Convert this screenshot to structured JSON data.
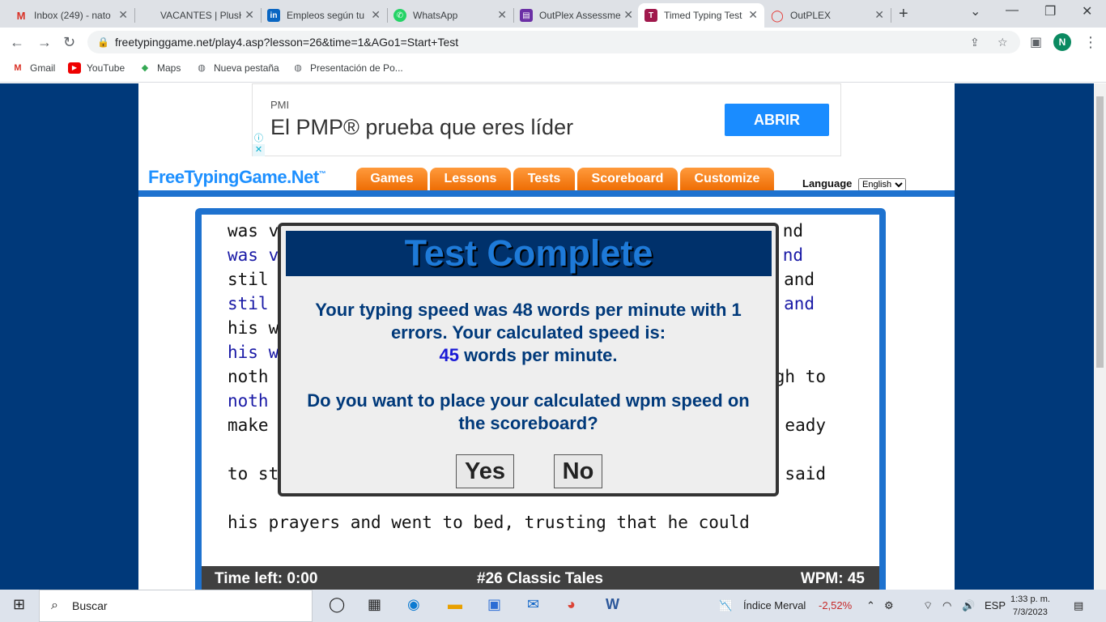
{
  "browser": {
    "tabs": [
      {
        "title": "Inbox (249) - nato",
        "icon_color": "#d93025",
        "icon_glyph": "M"
      },
      {
        "title": "VACANTES | PlusHR",
        "icon_color": "#777777",
        "icon_glyph": ""
      },
      {
        "title": "Empleos según tu perfil",
        "icon_color": "#0a66c2",
        "icon_glyph": "in"
      },
      {
        "title": "WhatsApp",
        "icon_color": "#25d366",
        "icon_glyph": "✆"
      },
      {
        "title": "OutPlex Assessment",
        "icon_color": "#6b2fa5",
        "icon_glyph": "▤"
      },
      {
        "title": "Timed Typing Test",
        "icon_color": "#a0184c",
        "icon_glyph": "T"
      },
      {
        "title": "OutPLEX",
        "icon_color": "#e53935",
        "icon_glyph": "◯"
      }
    ],
    "url": "freetypinggame.net/play4.asp?lesson=26&time=1&AGo1=Start+Test",
    "profile_initial": "N",
    "bookmarks": [
      "Gmail",
      "YouTube",
      "Maps",
      "Nueva pestaña",
      "Presentación de Po..."
    ]
  },
  "ad": {
    "brand": "PMI",
    "headline": "El PMP® prueba que eres líder",
    "cta": "ABRIR"
  },
  "site": {
    "logo": "FreeTypingGame.Net",
    "logo_tm": "™",
    "menu": [
      "Games",
      "Lessons",
      "Tests",
      "Scoreboard",
      "Customize"
    ],
    "language_label": "Language",
    "language_value": "English"
  },
  "typing": {
    "lines": [
      {
        "text": "was v",
        "right": "nd",
        "kind": "src"
      },
      {
        "text": "was v",
        "right": "nd",
        "kind": "typed"
      },
      {
        "text": "stil",
        "right": "and",
        "kind": "src"
      },
      {
        "text": "stil",
        "right": "and",
        "kind": "typed"
      },
      {
        "text": "his w",
        "right": "",
        "kind": "src"
      },
      {
        "text": "his w",
        "right": "",
        "kind": "typed"
      },
      {
        "text": "noth",
        "right": "gh to",
        "kind": "src"
      },
      {
        "text": "noth",
        "right": "",
        "kind": "typed"
      },
      {
        "text": "make",
        "right": "eady",
        "kind": "src"
      },
      {
        "text": "to st",
        "right": "said",
        "kind": "src"
      },
      {
        "text": "his prayers and went to bed, trusting that he could",
        "right": "",
        "kind": "src"
      }
    ],
    "status": {
      "time_left": "Time left: 0:00",
      "lesson": "#26 Classic Tales",
      "wpm": "WPM: 45"
    }
  },
  "modal": {
    "title": "Test Complete",
    "line1": "Your typing speed was 48 words per minute with 1",
    "line2": "errors. Your calculated speed is:",
    "speed": "45",
    "speed_suffix": "words per minute.",
    "question1": "Do you want to place your calculated wpm speed on",
    "question2": "the scoreboard?",
    "yes": "Yes",
    "no": "No"
  },
  "taskbar": {
    "search_placeholder": "Buscar",
    "market": "Índice Merval",
    "market_change": "-2,52%",
    "lang": "ESP",
    "time": "1:33 p. m.",
    "date": "7/3/2023"
  }
}
